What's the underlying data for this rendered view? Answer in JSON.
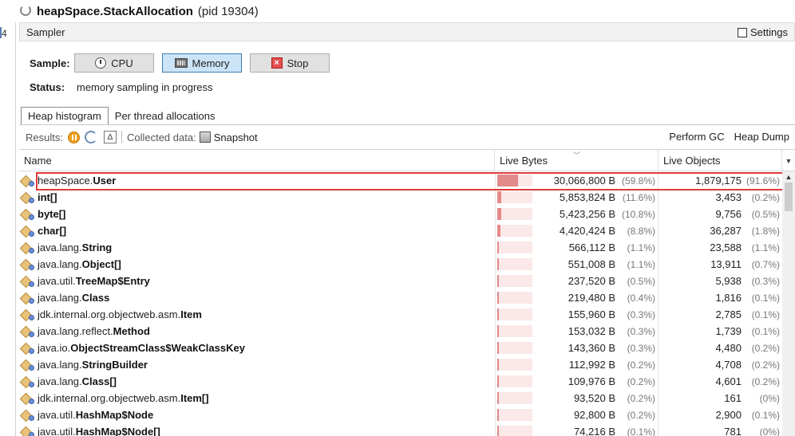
{
  "title": {
    "main": "heapSpace.StackAllocation",
    "pid": "(pid 19304)"
  },
  "gutter": {
    "label": "4"
  },
  "sampler": {
    "header": "Sampler",
    "settings_label": "Settings"
  },
  "sample": {
    "label": "Sample:",
    "buttons": {
      "cpu": "CPU",
      "memory": "Memory",
      "stop": "Stop"
    },
    "active": "memory"
  },
  "status": {
    "label": "Status:",
    "value": "memory sampling in progress"
  },
  "tabs": [
    {
      "label": "Heap histogram",
      "active": true
    },
    {
      "label": "Per thread allocations",
      "active": false
    }
  ],
  "toolbar": {
    "results_label": "Results:",
    "collected_label": "Collected data:",
    "snapshot_label": "Snapshot",
    "perform_gc": "Perform GC",
    "heap_dump": "Heap Dump"
  },
  "columns": {
    "name": "Name",
    "live_bytes": "Live Bytes",
    "live_objects": "Live Objects"
  },
  "colors": {
    "bar_fill": "#e38a8a",
    "bar_bg": "#fbe8e8",
    "highlight": "#e03a3a"
  },
  "rows": [
    {
      "pkg": "heapSpace.",
      "cls": "User",
      "bytes": "30,066,800 B",
      "bytes_pct": "(59.8%)",
      "bytes_frac": 0.598,
      "objs": "1,879,175",
      "objs_pct": "(91.6%)"
    },
    {
      "pkg": "",
      "cls": "int[]",
      "bytes": "5,853,824 B",
      "bytes_pct": "(11.6%)",
      "bytes_frac": 0.116,
      "objs": "3,453",
      "objs_pct": "(0.2%)"
    },
    {
      "pkg": "",
      "cls": "byte[]",
      "bytes": "5,423,256 B",
      "bytes_pct": "(10.8%)",
      "bytes_frac": 0.108,
      "objs": "9,756",
      "objs_pct": "(0.5%)"
    },
    {
      "pkg": "",
      "cls": "char[]",
      "bytes": "4,420,424 B",
      "bytes_pct": "(8.8%)",
      "bytes_frac": 0.088,
      "objs": "36,287",
      "objs_pct": "(1.8%)"
    },
    {
      "pkg": "java.lang.",
      "cls": "String",
      "bytes": "566,112 B",
      "bytes_pct": "(1.1%)",
      "bytes_frac": 0.011,
      "objs": "23,588",
      "objs_pct": "(1.1%)"
    },
    {
      "pkg": "java.lang.",
      "cls": "Object[]",
      "bytes": "551,008 B",
      "bytes_pct": "(1.1%)",
      "bytes_frac": 0.011,
      "objs": "13,911",
      "objs_pct": "(0.7%)"
    },
    {
      "pkg": "java.util.",
      "cls": "TreeMap$Entry",
      "bytes": "237,520 B",
      "bytes_pct": "(0.5%)",
      "bytes_frac": 0.005,
      "objs": "5,938",
      "objs_pct": "(0.3%)"
    },
    {
      "pkg": "java.lang.",
      "cls": "Class",
      "bytes": "219,480 B",
      "bytes_pct": "(0.4%)",
      "bytes_frac": 0.004,
      "objs": "1,816",
      "objs_pct": "(0.1%)"
    },
    {
      "pkg": "jdk.internal.org.objectweb.asm.",
      "cls": "Item",
      "bytes": "155,960 B",
      "bytes_pct": "(0.3%)",
      "bytes_frac": 0.003,
      "objs": "2,785",
      "objs_pct": "(0.1%)"
    },
    {
      "pkg": "java.lang.reflect.",
      "cls": "Method",
      "bytes": "153,032 B",
      "bytes_pct": "(0.3%)",
      "bytes_frac": 0.003,
      "objs": "1,739",
      "objs_pct": "(0.1%)"
    },
    {
      "pkg": "java.io.",
      "cls": "ObjectStreamClass$WeakClassKey",
      "bytes": "143,360 B",
      "bytes_pct": "(0.3%)",
      "bytes_frac": 0.003,
      "objs": "4,480",
      "objs_pct": "(0.2%)"
    },
    {
      "pkg": "java.lang.",
      "cls": "StringBuilder",
      "bytes": "112,992 B",
      "bytes_pct": "(0.2%)",
      "bytes_frac": 0.002,
      "objs": "4,708",
      "objs_pct": "(0.2%)"
    },
    {
      "pkg": "java.lang.",
      "cls": "Class[]",
      "bytes": "109,976 B",
      "bytes_pct": "(0.2%)",
      "bytes_frac": 0.002,
      "objs": "4,601",
      "objs_pct": "(0.2%)"
    },
    {
      "pkg": "jdk.internal.org.objectweb.asm.",
      "cls": "Item[]",
      "bytes": "93,520 B",
      "bytes_pct": "(0.2%)",
      "bytes_frac": 0.002,
      "objs": "161",
      "objs_pct": "(0%)"
    },
    {
      "pkg": "java.util.",
      "cls": "HashMap$Node",
      "bytes": "92,800 B",
      "bytes_pct": "(0.2%)",
      "bytes_frac": 0.002,
      "objs": "2,900",
      "objs_pct": "(0.1%)"
    },
    {
      "pkg": "java.util.",
      "cls": "HashMap$Node[]",
      "bytes": "74,216 B",
      "bytes_pct": "(0.1%)",
      "bytes_frac": 0.001,
      "objs": "781",
      "objs_pct": "(0%)"
    }
  ]
}
